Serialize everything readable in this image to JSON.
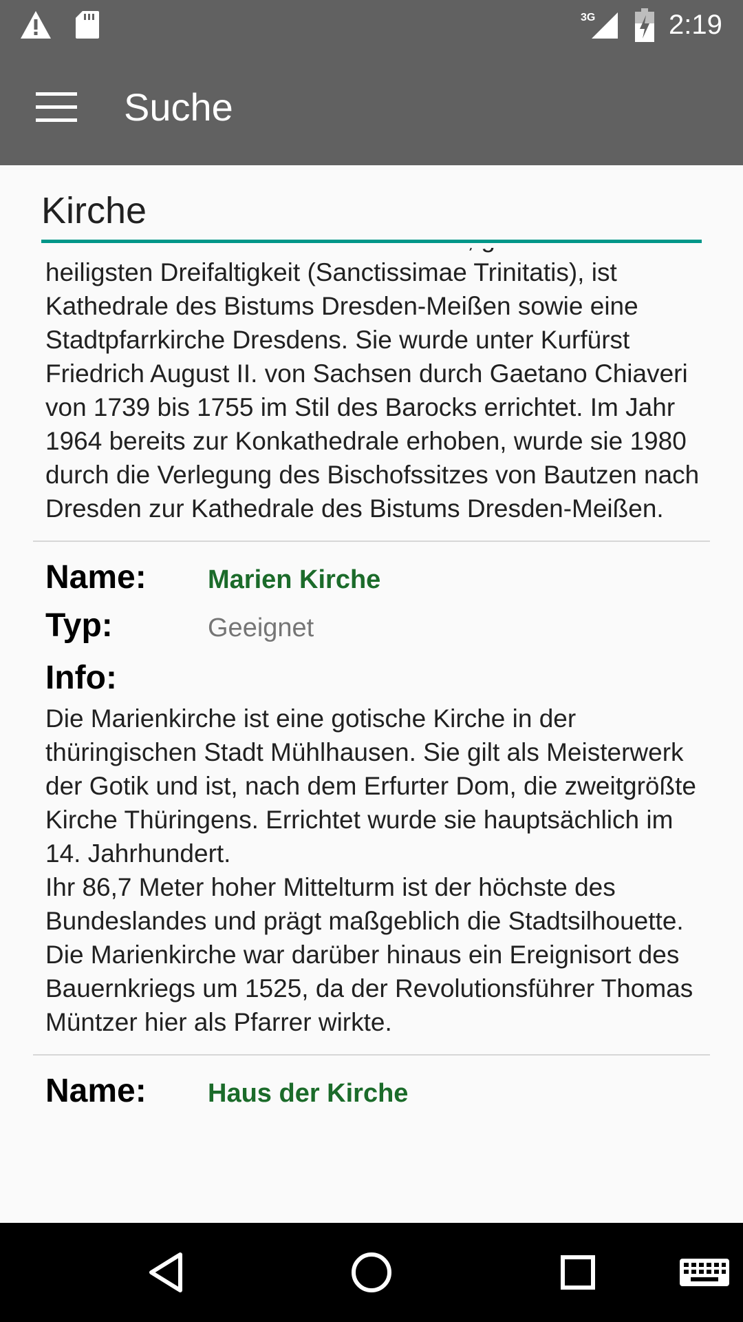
{
  "status_bar": {
    "time": "2:19",
    "network": "3G",
    "icons": [
      "warning-icon",
      "sd-card-icon",
      "signal-3g-icon",
      "battery-charging-icon"
    ]
  },
  "app_bar": {
    "title": "Suche",
    "menu_icon": "hamburger-menu-icon"
  },
  "search": {
    "value": "Kirche"
  },
  "results": [
    {
      "info": "Die Katholische Hofkirche in Dresden, geweiht der heiligsten Dreifaltigkeit (Sanctissimae Trinitatis), ist Kathedrale des Bistums Dresden-Meißen sowie eine Stadtpfarrkirche Dresdens. Sie wurde unter Kurfürst Friedrich August II. von Sachsen durch Gaetano Chiaveri von 1739 bis 1755 im Stil des Barocks errichtet. Im Jahr 1964 bereits zur Konkathedrale erhoben, wurde sie 1980 durch die Verlegung des Bischofssitzes von Bautzen nach Dresden zur Kathedrale des Bistums Dresden-Meißen."
    },
    {
      "name_label": "Name:",
      "name": "Marien Kirche",
      "type_label": "Typ:",
      "type": "Geeignet",
      "info_label": "Info:",
      "info": "Die Marienkirche ist eine gotische Kirche in der thüringischen Stadt Mühlhausen. Sie gilt als Meisterwerk der Gotik und ist, nach dem Erfurter Dom, die zweitgrößte Kirche Thüringens. Errichtet wurde sie hauptsächlich im 14. Jahrhundert.\nIhr 86,7 Meter hoher Mittelturm ist der höchste des Bundeslandes und prägt maßgeblich die Stadtsilhouette. Die Marienkirche war darüber hinaus ein Ereignisort des Bauernkriegs um 1525, da der Revolutionsführer Thomas Müntzer hier als Pfarrer wirkte."
    },
    {
      "name_label": "Name:",
      "name": "Haus der Kirche"
    }
  ],
  "nav_bar": {
    "icons": [
      "back-icon",
      "home-icon",
      "recents-icon",
      "keyboard-icon"
    ]
  },
  "colors": {
    "bar": "#616161",
    "accent": "#009688",
    "name_green": "#1b6b2a"
  }
}
